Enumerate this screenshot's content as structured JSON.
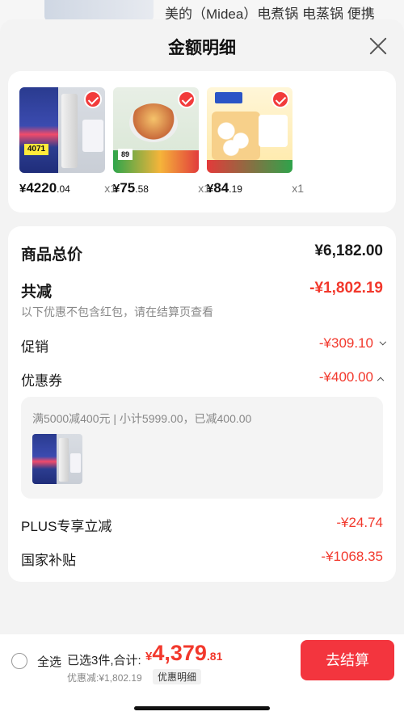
{
  "background": {
    "title": "美的（Midea）电煮锅 电蒸锅 便携"
  },
  "sheet": {
    "title": "金额明细"
  },
  "products": [
    {
      "yen": "¥",
      "int": "4220",
      "dec": ".04",
      "qty": "x1"
    },
    {
      "yen": "¥",
      "int": "75",
      "dec": ".58",
      "qty": "x1"
    },
    {
      "yen": "¥",
      "int": "84",
      "dec": ".19",
      "qty": "x1"
    }
  ],
  "summary": {
    "total_label": "商品总价",
    "total_value": "¥6,182.00",
    "reduce_label": "共减",
    "reduce_value": "-¥1,802.19",
    "reduce_note": "以下优惠不包含红包，请在结算页查看",
    "promo_label": "促销",
    "promo_value": "-¥309.10",
    "coupon_label": "优惠券",
    "coupon_value": "-¥400.00",
    "coupon_detail": "满5000减400元 | 小计5999.00，已减400.00",
    "plus_label": "PLUS专享立减",
    "plus_value": "-¥24.74",
    "subsidy_label": "国家补贴",
    "subsidy_value": "-¥1068.35"
  },
  "bottom": {
    "select_all": "全选",
    "selected": "已选3件,合计:",
    "total_yen": "¥",
    "total_int": "4,379",
    "total_dec": ".81",
    "saved": "优惠减:¥1,802.19",
    "detail_tag": "优惠明细",
    "checkout": "去结算"
  },
  "colors": {
    "accent": "#f2382c",
    "checkout": "#f3353e"
  }
}
